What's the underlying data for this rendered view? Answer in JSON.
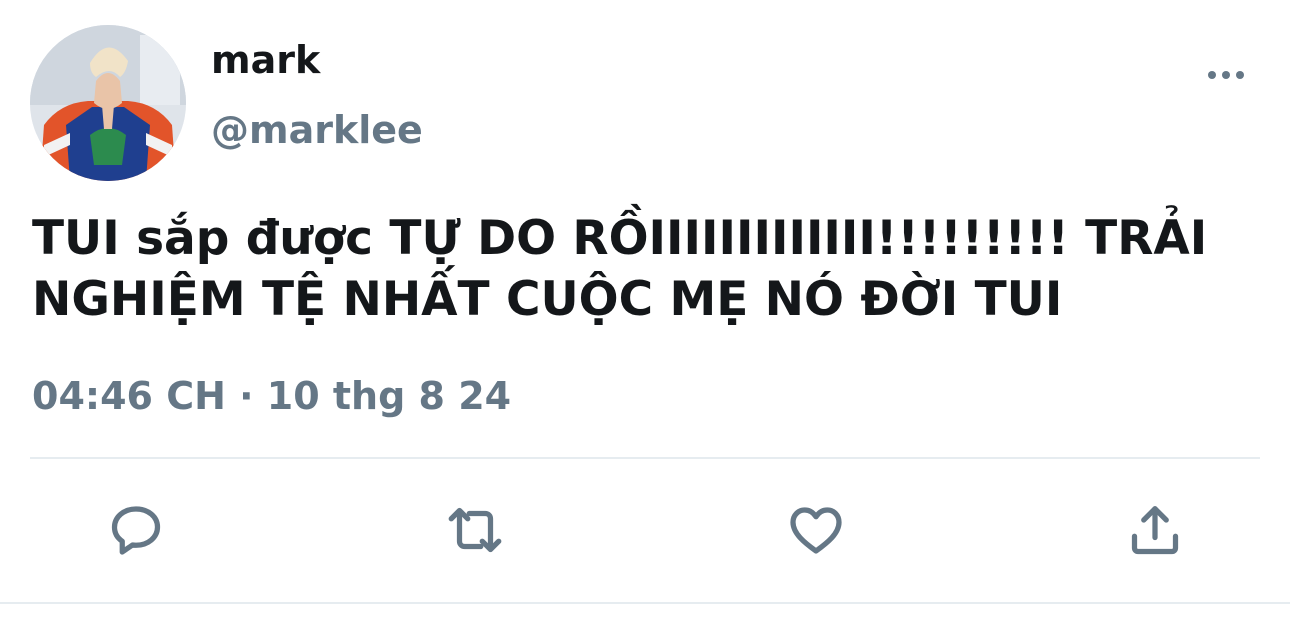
{
  "tweet": {
    "display_name": "mark",
    "handle": "@marklee",
    "text": "TUI sắp được TỰ DO RỒIIIIIIIIIIIII!!!!!!!!! TRẢI NGHIỆM TỆ NHẤT CUỘC MẸ NÓ ĐỜI TUI",
    "timestamp": "04:46 CH · 10 thg 8 24"
  },
  "icons": {
    "more": "more-horizontal-icon",
    "reply": "reply-icon",
    "retweet": "retweet-icon",
    "like": "heart-icon",
    "share": "share-icon"
  },
  "colors": {
    "primary_text": "#14171a",
    "secondary_text": "#657786",
    "divider": "#e6ecf0",
    "background": "#ffffff"
  }
}
